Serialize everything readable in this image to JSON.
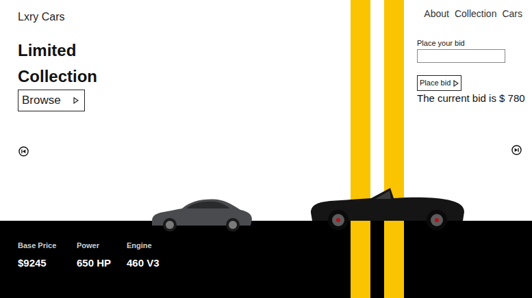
{
  "brand": "Lxry Cars",
  "hero": {
    "title_lines": [
      "Limited",
      "Collection"
    ],
    "browse_button": {
      "label": "Browse"
    }
  },
  "nav": {
    "items": [
      "About",
      "Collection",
      "Cars"
    ]
  },
  "bid": {
    "label": "Place your bid",
    "value": "",
    "button": "Place bid",
    "current": "The current bid is $ 780"
  },
  "specs": [
    {
      "label": "Base Price",
      "value": "$9245"
    },
    {
      "label": "Power",
      "value": "650 HP"
    },
    {
      "label": "Engine",
      "value": "460 V3"
    }
  ]
}
